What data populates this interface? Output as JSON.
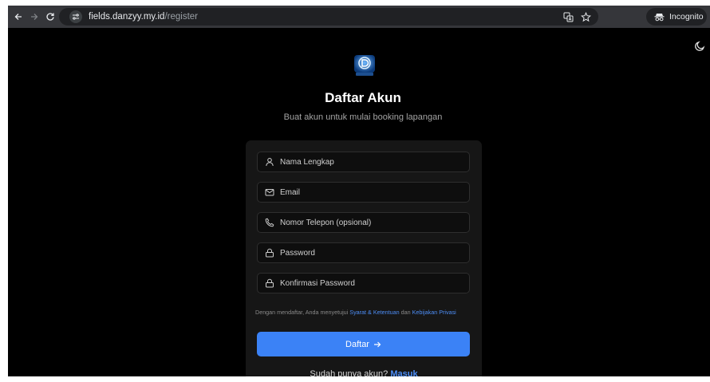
{
  "browser": {
    "url_host": "fields.danzyy.my.id",
    "url_path": "/register",
    "incognito_label": "Incognito"
  },
  "page": {
    "title": "Daftar Akun",
    "subtitle": "Buat akun untuk mulai booking lapangan",
    "logo_icon": "app-logo-icon",
    "fields": [
      {
        "name": "full-name-field",
        "icon": "user-icon",
        "placeholder": "Nama Lengkap",
        "value": ""
      },
      {
        "name": "email-field",
        "icon": "mail-icon",
        "placeholder": "Email",
        "value": ""
      },
      {
        "name": "phone-field",
        "icon": "phone-icon",
        "placeholder": "Nomor Telepon (opsional)",
        "value": ""
      },
      {
        "name": "password-field",
        "icon": "lock-icon",
        "placeholder": "Password",
        "value": ""
      },
      {
        "name": "confirm-password-field",
        "icon": "lock-icon",
        "placeholder": "Konfirmasi Password",
        "value": ""
      }
    ],
    "terms": {
      "prefix": "Dengan mendaftar, Anda menyetujui ",
      "terms_link": "Syarat & Ketentuan",
      "middle": " dan ",
      "privacy_link": "Kebijakan Privasi"
    },
    "submit_label": "Daftar",
    "login_prompt": "Sudah punya akun?",
    "login_link": "Masuk"
  },
  "colors": {
    "accent": "#3b82f6",
    "link": "#4d8ef7",
    "background": "#000000",
    "card": "#161616"
  }
}
